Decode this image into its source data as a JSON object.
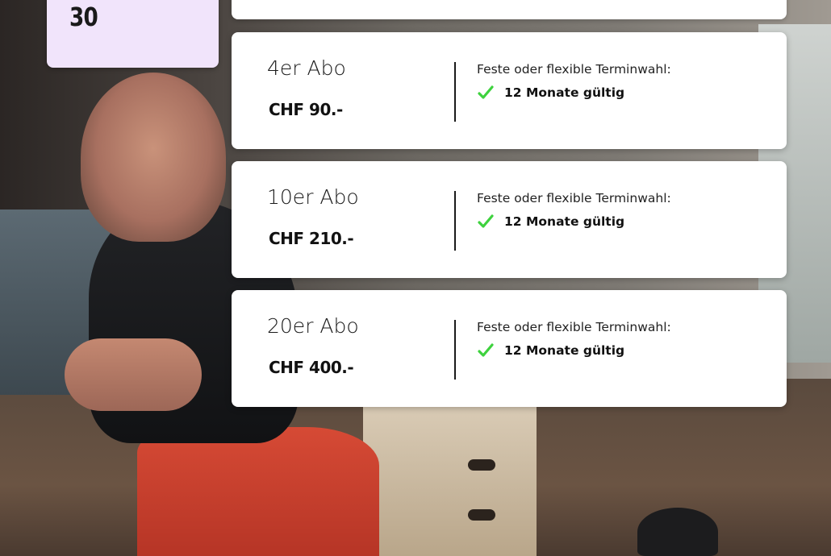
{
  "badge": {
    "number": "30"
  },
  "colors": {
    "badge_bg": "#f1e4fb",
    "check": "#3ed23e",
    "card_bg": "#ffffff"
  },
  "cards": [
    {
      "title": "4er Abo",
      "price": "CHF 90.-",
      "term_label": "Feste oder flexible Terminwahl:",
      "feature": "12 Monate gültig"
    },
    {
      "title": "10er Abo",
      "price": "CHF 210.-",
      "term_label": "Feste oder flexible Terminwahl:",
      "feature": "12 Monate gültig"
    },
    {
      "title": "20er Abo",
      "price": "CHF 400.-",
      "term_label": "Feste oder flexible Terminwahl:",
      "feature": "12 Monate gültig"
    }
  ]
}
